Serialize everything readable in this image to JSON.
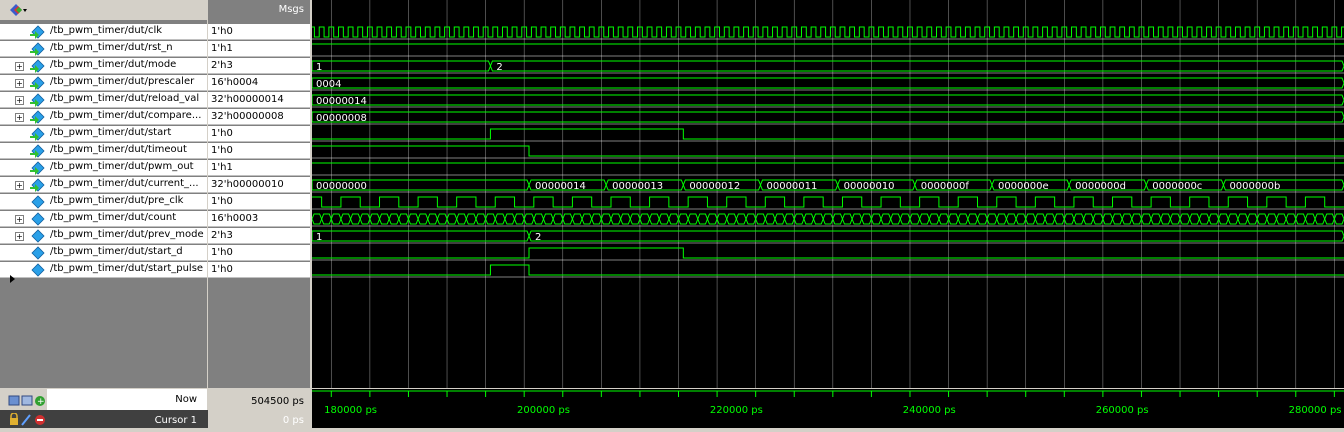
{
  "header": {
    "msgs_label": "Msgs"
  },
  "signals": [
    {
      "name": "/tb_pwm_timer/dut/clk",
      "value": "1'h0",
      "bus": false
    },
    {
      "name": "/tb_pwm_timer/dut/rst_n",
      "value": "1'h1",
      "bus": false
    },
    {
      "name": "/tb_pwm_timer/dut/mode",
      "value": "2'h3",
      "bus": true
    },
    {
      "name": "/tb_pwm_timer/dut/prescaler",
      "value": "16'h0004",
      "bus": true
    },
    {
      "name": "/tb_pwm_timer/dut/reload_val",
      "value": "32'h00000014",
      "bus": true
    },
    {
      "name": "/tb_pwm_timer/dut/compare...",
      "value": "32'h00000008",
      "bus": true
    },
    {
      "name": "/tb_pwm_timer/dut/start",
      "value": "1'h0",
      "bus": false
    },
    {
      "name": "/tb_pwm_timer/dut/timeout",
      "value": "1'h0",
      "bus": false
    },
    {
      "name": "/tb_pwm_timer/dut/pwm_out",
      "value": "1'h1",
      "bus": false
    },
    {
      "name": "/tb_pwm_timer/dut/current_...",
      "value": "32'h00000010",
      "bus": true
    },
    {
      "name": "/tb_pwm_timer/dut/pre_clk",
      "value": "1'h0",
      "bus": false
    },
    {
      "name": "/tb_pwm_timer/dut/count",
      "value": "16'h0003",
      "bus": true
    },
    {
      "name": "/tb_pwm_timer/dut/prev_mode",
      "value": "2'h3",
      "bus": true
    },
    {
      "name": "/tb_pwm_timer/dut/start_d",
      "value": "1'h0",
      "bus": false
    },
    {
      "name": "/tb_pwm_timer/dut/start_pulse",
      "value": "1'h0",
      "bus": false
    }
  ],
  "bus_labels": {
    "mode": [
      "1",
      "2"
    ],
    "prescaler": [
      "0004"
    ],
    "reload_val": [
      "00000014"
    ],
    "compare": [
      "00000008"
    ],
    "current": [
      "00000000",
      "00000014",
      "00000013",
      "00000012",
      "00000011",
      "00000010",
      "0000000f",
      "0000000e",
      "0000000d",
      "0000000c",
      "0000000b"
    ],
    "prev_mode": [
      "1",
      "2"
    ]
  },
  "status": {
    "now_label": "Now",
    "now_value": "504500 ps",
    "cursor_label": "Cursor 1",
    "cursor_value": "0 ps"
  },
  "timeline": {
    "ticks": [
      "180000 ps",
      "200000 ps",
      "220000 ps",
      "240000 ps",
      "260000 ps",
      "280000 ps"
    ]
  },
  "colors": {
    "wave": "#00ff00",
    "grid": "#808080",
    "background": "#000000"
  },
  "icons": {
    "logo": "modelsim-logo-icon",
    "signal": "signal-icon",
    "expand": "expand-plus-icon"
  }
}
